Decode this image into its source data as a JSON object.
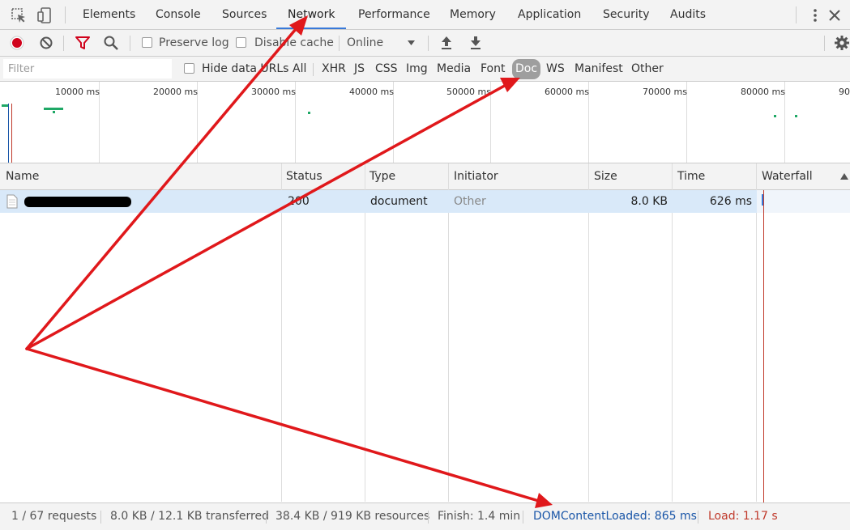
{
  "tabs": [
    {
      "label": "Elements"
    },
    {
      "label": "Console"
    },
    {
      "label": "Sources"
    },
    {
      "label": "Network"
    },
    {
      "label": "Performance"
    },
    {
      "label": "Memory"
    },
    {
      "label": "Application"
    },
    {
      "label": "Security"
    },
    {
      "label": "Audits"
    }
  ],
  "active_tab": "Network",
  "toolbar": {
    "preserve_log_label": "Preserve log",
    "disable_cache_label": "Disable cache",
    "throttling_value": "Online"
  },
  "filter": {
    "placeholder": "Filter",
    "hide_data_urls_label": "Hide data URLs",
    "types": [
      "All",
      "XHR",
      "JS",
      "CSS",
      "Img",
      "Media",
      "Font",
      "Doc",
      "WS",
      "Manifest",
      "Other"
    ],
    "selected_type": "Doc"
  },
  "overview": {
    "tick_labels": [
      "10000 ms",
      "20000 ms",
      "30000 ms",
      "40000 ms",
      "50000 ms",
      "60000 ms",
      "70000 ms",
      "80000 ms",
      "90"
    ]
  },
  "table": {
    "columns": {
      "name": "Name",
      "status": "Status",
      "type": "Type",
      "initiator": "Initiator",
      "size": "Size",
      "time": "Time",
      "waterfall": "Waterfall"
    },
    "rows": [
      {
        "status": "200",
        "type": "document",
        "initiator": "Other",
        "size": "8.0 KB",
        "time": "626 ms"
      }
    ]
  },
  "status": {
    "requests": "1 / 67 requests",
    "transferred": "8.0 KB / 12.1 KB transferred",
    "resources": "38.4 KB / 919 KB resources",
    "finish": "Finish: 1.4 min",
    "dom_content_loaded": "DOMContentLoaded: 865 ms",
    "load": "Load: 1.17 s"
  },
  "colors": {
    "record": "#d0021b",
    "tab_underline": "#3879d9",
    "selected_row": "#d9e9f9",
    "dom_content_loaded": "#1a56a8",
    "load": "#c0392b",
    "annotation_arrow": "#e0181b"
  },
  "icons": [
    "select-element-icon",
    "device-toggle-icon",
    "more-vert-icon",
    "close-icon",
    "record-icon",
    "clear-icon",
    "filter-icon",
    "search-icon",
    "dropdown-arrow-icon",
    "upload-icon",
    "download-icon",
    "gear-icon",
    "document-icon",
    "sort-ascending-icon"
  ]
}
